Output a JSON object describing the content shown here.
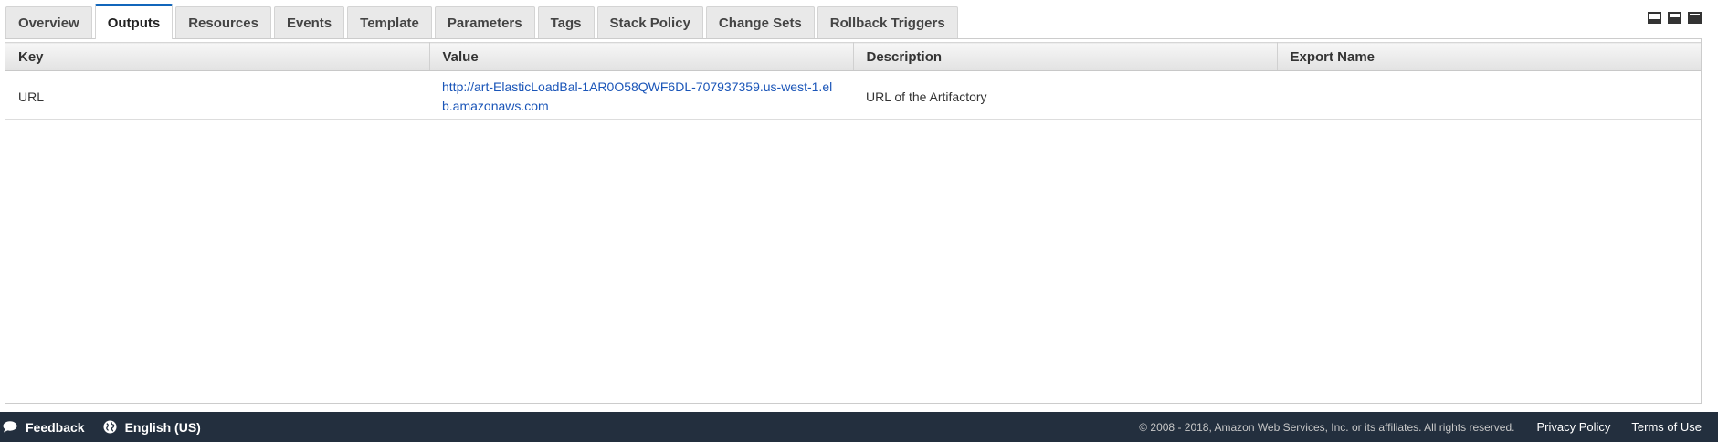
{
  "tabs": [
    {
      "label": "Overview",
      "active": false
    },
    {
      "label": "Outputs",
      "active": true
    },
    {
      "label": "Resources",
      "active": false
    },
    {
      "label": "Events",
      "active": false
    },
    {
      "label": "Template",
      "active": false
    },
    {
      "label": "Parameters",
      "active": false
    },
    {
      "label": "Tags",
      "active": false
    },
    {
      "label": "Stack Policy",
      "active": false
    },
    {
      "label": "Change Sets",
      "active": false
    },
    {
      "label": "Rollback Triggers",
      "active": false
    }
  ],
  "pane_controls": [
    "pane-small-icon",
    "pane-medium-icon",
    "pane-large-icon"
  ],
  "outputs_table": {
    "columns": [
      "Key",
      "Value",
      "Description",
      "Export Name"
    ],
    "rows": [
      {
        "key": "URL",
        "value": "http://art-ElasticLoadBal-1AR0O58QWF6DL-707937359.us-west-1.elb.amazonaws.com",
        "description": "URL of the Artifactory",
        "export_name": ""
      }
    ]
  },
  "footer": {
    "feedback_label": "Feedback",
    "language_label": "English (US)",
    "copyright": "© 2008 - 2018, Amazon Web Services, Inc. or its affiliates. All rights reserved.",
    "privacy_label": "Privacy Policy",
    "terms_label": "Terms of Use"
  },
  "colors": {
    "active_tab_accent": "#1166bb",
    "link": "#1a55b8",
    "footer_background": "#232f3e"
  }
}
